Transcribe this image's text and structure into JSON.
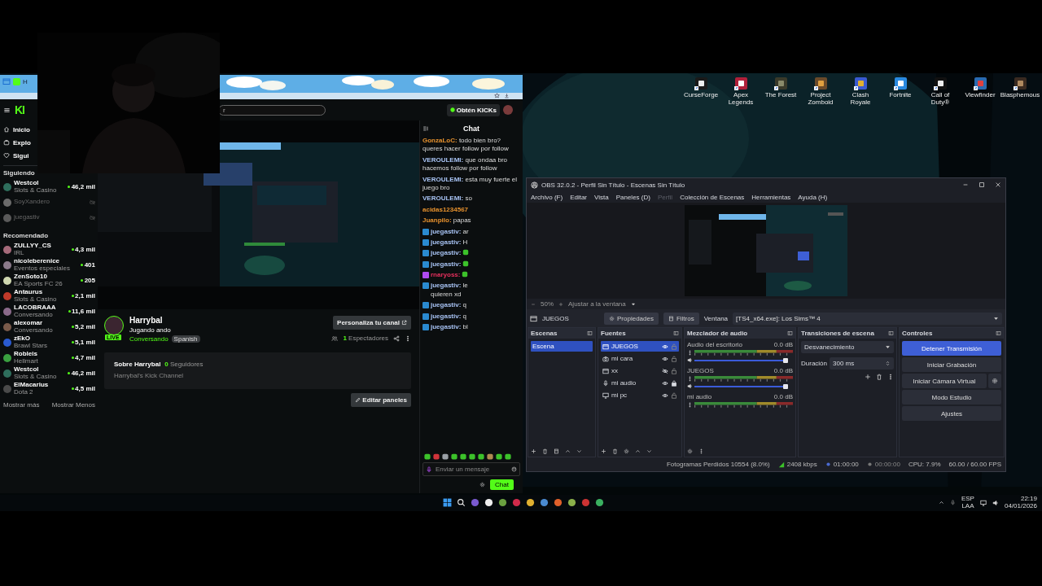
{
  "browser": {
    "tab_title": "H",
    "search": {
      "placeholder": "r"
    },
    "kicks_button": "Obtén KICKs",
    "logo": "KI",
    "nav": [
      "Inicio",
      "Explo",
      "Sigui"
    ],
    "following": {
      "title": "Siguiendo",
      "items": [
        {
          "name": "Westcol",
          "category": "Slots & Casino",
          "viewers": "46,2 mil",
          "live": true
        },
        {
          "name": "SoyXandero",
          "live": false
        },
        {
          "name": "juegastiv",
          "live": false
        }
      ]
    },
    "recommended": {
      "title": "Recomendado",
      "items": [
        {
          "name": "ZULLYY_CS",
          "category": "IRL",
          "viewers": "4,3 mil",
          "live": true
        },
        {
          "name": "nicoleberenice",
          "category": "Eventos especiales",
          "viewers": "401",
          "live": true
        },
        {
          "name": "ZenSoto10",
          "category": "EA Sports FC 26",
          "viewers": "205",
          "live": true
        },
        {
          "name": "Antaurus",
          "category": "Slots & Casino",
          "viewers": "2,1 mil",
          "live": true
        },
        {
          "name": "LACOBRAAA",
          "category": "Conversando",
          "viewers": "11,6 mil",
          "live": true
        },
        {
          "name": "alexomar",
          "category": "Conversando",
          "viewers": "5,2 mil",
          "live": true
        },
        {
          "name": "zEkO",
          "category": "Brawl Stars",
          "viewers": "5,1 mil",
          "live": true
        },
        {
          "name": "Robleis",
          "category": "Hellmart",
          "viewers": "4,7 mil",
          "live": true
        },
        {
          "name": "Westcol",
          "category": "Slots & Casino",
          "viewers": "46,2 mil",
          "live": true
        },
        {
          "name": "ElMacarius",
          "category": "Dota 2",
          "viewers": "4,5 mil",
          "live": true
        }
      ]
    },
    "show_more": "Mostrar más",
    "show_less": "Mostrar Menos",
    "channel": {
      "name": "Harrybal",
      "live_badge": "LIVE",
      "title": "Jugando ando",
      "category": "Conversando",
      "tag": "Spanish",
      "customize_button": "Personaliza tu canal",
      "viewers_count": "1",
      "viewers_label": "Espectadores",
      "about_title": "Sobre Harrybal",
      "followers_count": "0",
      "followers_label": "Seguidores",
      "bio": "Harrybal's Kick Channel",
      "edit_button": "Editar paneles"
    },
    "chat": {
      "title": "Chat",
      "messages": [
        {
          "kind": "text",
          "user": "GonzaLoC:",
          "color": "#e8922e",
          "text": "todo bien bro? queres hacer follow por follow"
        },
        {
          "kind": "text",
          "user": "VEROULEMI:",
          "color": "#a9c4f5",
          "text": "que ondaa bro hacemos follow por follow"
        },
        {
          "kind": "text",
          "user": "VEROULEMI:",
          "color": "#a9c4f5",
          "text": "esta muy fuerte el juego bro"
        },
        {
          "kind": "text",
          "user": "VEROULEMI:",
          "color": "#a9c4f5",
          "text": "so"
        },
        {
          "kind": "text",
          "user": "acidas1234567",
          "color": "#e8922e"
        },
        {
          "kind": "text",
          "user": "Juanpilo:",
          "color": "#e8922e",
          "text": "papas"
        },
        {
          "kind": "text",
          "user": "juegastiv:",
          "color": "#a9c4f5",
          "badge": {
            "color": "#2a8ad0"
          },
          "text": "ar"
        },
        {
          "kind": "text",
          "user": "juegastiv:",
          "color": "#a9c4f5",
          "badge": {
            "color": "#2a8ad0"
          },
          "text": "H"
        },
        {
          "kind": "emote",
          "user": "juegastiv:",
          "color": "#a9c4f5",
          "badge": {
            "color": "#2a8ad0"
          }
        },
        {
          "kind": "emote",
          "user": "juegastiv:",
          "color": "#a9c4f5",
          "badge": {
            "color": "#2a8ad0"
          }
        },
        {
          "kind": "emote",
          "user": "rnaryoss:",
          "color": "#e8305e",
          "badge": {
            "color": "#b04af0"
          }
        },
        {
          "kind": "text",
          "user": "juegastiv:",
          "color": "#a9c4f5",
          "badge": {
            "color": "#2a8ad0"
          },
          "text": "le",
          "continuation": "quieren xd"
        },
        {
          "kind": "text",
          "user": "juegastiv:",
          "color": "#a9c4f5",
          "badge": {
            "color": "#2a8ad0"
          },
          "text": "q"
        },
        {
          "kind": "text",
          "user": "juegastiv:",
          "color": "#a9c4f5",
          "badge": {
            "color": "#2a8ad0"
          },
          "text": "q"
        },
        {
          "kind": "text",
          "user": "juegastiv:",
          "color": "#a9c4f5",
          "badge": {
            "color": "#2a8ad0"
          },
          "text": "bl"
        }
      ],
      "placeholder": "Enviar un mensaje",
      "send_button": "Chat"
    }
  },
  "obs": {
    "title": "OBS 32.0.2 - Perfil Sin Título - Escenas Sin Título",
    "menu": [
      {
        "label": "Archivo (F)",
        "disabled": false
      },
      {
        "label": "Editar",
        "disabled": false
      },
      {
        "label": "Vista",
        "disabled": false
      },
      {
        "label": "Paneles (D)",
        "disabled": false
      },
      {
        "label": "Perfil",
        "disabled": true
      },
      {
        "label": "Colección de Escenas",
        "disabled": false
      },
      {
        "label": "Herramientas",
        "disabled": false
      },
      {
        "label": "Ayuda (H)",
        "disabled": false
      }
    ],
    "preview_toolbar": {
      "zoom": "50%",
      "fit": "Ajustar a la ventana"
    },
    "source_bar": {
      "source": "JUEGOS",
      "properties": "Propiedades",
      "filters": "Filtros",
      "window_label": "Ventana",
      "window_value": "[TS4_x64.exe]: Los Sims™ 4"
    },
    "scenes": {
      "title": "Escenas",
      "items": [
        {
          "name": "Escena",
          "selected": true
        }
      ]
    },
    "sources": {
      "title": "Fuentes",
      "items": [
        {
          "name": "JUEGOS",
          "kind": "window",
          "visible": true,
          "locked": false,
          "selected": true
        },
        {
          "name": "mi cara",
          "kind": "camera",
          "visible": true,
          "locked": false,
          "selected": false
        },
        {
          "name": "xx",
          "kind": "window",
          "visible": false,
          "locked": false,
          "selected": false
        },
        {
          "name": "mi audio",
          "kind": "mic",
          "visible": true,
          "locked": true,
          "selected": false
        },
        {
          "name": "mi pc",
          "kind": "display",
          "visible": true,
          "locked": false,
          "selected": false
        }
      ]
    },
    "mixer": {
      "title": "Mezclador de audio",
      "channels": [
        {
          "name": "Audio del escritorio",
          "reading": "0.0 dB",
          "level": 0.97
        },
        {
          "name": "JUEGOS",
          "reading": "0.0 dB",
          "level": 0.97
        },
        {
          "name": "mi audio",
          "reading": "0.0 dB"
        }
      ]
    },
    "transitions": {
      "title": "Transiciones de escena",
      "type": "Desvanecimiento",
      "duration_label": "Duración",
      "duration": "300 ms"
    },
    "controls": {
      "title": "Controles",
      "buttons": [
        {
          "label": "Detener Transmisión",
          "active": true,
          "settings_button": false
        },
        {
          "label": "Iniciar Grabación",
          "active": false,
          "settings_button": false
        },
        {
          "label": "Iniciar Cámara Virtual",
          "active": false,
          "settings_button": true
        },
        {
          "label": "Modo Estudio",
          "active": false,
          "settings_button": false
        },
        {
          "label": "Ajustes",
          "active": false,
          "settings_button": false
        }
      ]
    },
    "status_bar": {
      "dropped": "Fotogramas Perdidos 10554 (8.0%)",
      "bitrate": "2408 kbps",
      "stream_time": "01:00:00",
      "record_time": "00:00:00",
      "cpu": "CPU: 7.9%",
      "fps": "60.00 / 60.00 FPS"
    }
  },
  "desktop_icons": [
    {
      "label": "CurseForge"
    },
    {
      "label": "Apex Legends"
    },
    {
      "label": "The Forest"
    },
    {
      "label": "Project Zomboid"
    },
    {
      "label": "Clash Royale"
    },
    {
      "label": "Fortnite"
    },
    {
      "label": "Call of Duty®"
    },
    {
      "label": "Viewfinder"
    },
    {
      "label": "Blasphemous"
    }
  ],
  "taskbar": {
    "language": "ESP",
    "layout": "LAA",
    "time": "22:19",
    "date": "04/01/2026"
  }
}
